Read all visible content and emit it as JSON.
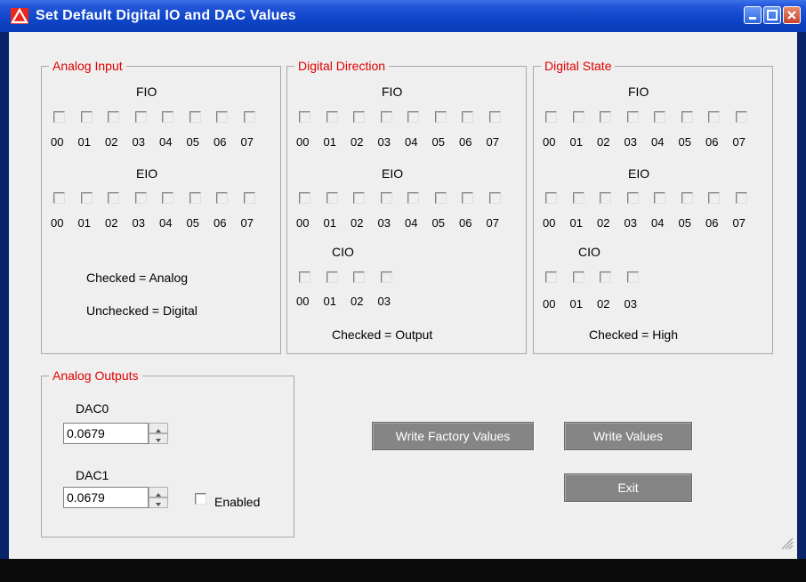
{
  "window": {
    "title": "Set Default Digital IO and DAC Values"
  },
  "analog_input": {
    "legend": "Analog Input",
    "fio_label": "FIO",
    "eio_label": "EIO",
    "note_checked": "Checked = Analog",
    "note_unchecked": "Unchecked = Digital"
  },
  "digital_direction": {
    "legend": "Digital Direction",
    "fio_label": "FIO",
    "eio_label": "EIO",
    "cio_label": "CIO",
    "note_checked": "Checked = Output"
  },
  "digital_state": {
    "legend": "Digital State",
    "fio_label": "FIO",
    "eio_label": "EIO",
    "cio_label": "CIO",
    "note_checked": "Checked = High"
  },
  "channels8": [
    "00",
    "01",
    "02",
    "03",
    "04",
    "05",
    "06",
    "07"
  ],
  "channels4": [
    "00",
    "01",
    "02",
    "03"
  ],
  "analog_outputs": {
    "legend": "Analog Outputs",
    "dac0_label": "DAC0",
    "dac0_value": "0.0679",
    "dac1_label": "DAC1",
    "dac1_value": "0.0679",
    "enabled_label": "Enabled"
  },
  "buttons": {
    "write_factory": "Write Factory Values",
    "write_values": "Write Values",
    "exit": "Exit"
  }
}
